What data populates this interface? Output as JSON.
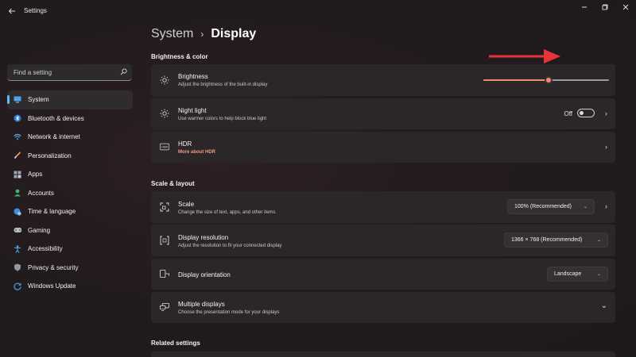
{
  "window": {
    "title": "Settings",
    "back_icon": "arrow-left-icon",
    "controls": [
      "minimize-icon",
      "maximize-icon",
      "close-icon"
    ]
  },
  "search": {
    "placeholder": "Find a setting",
    "icon": "search-icon"
  },
  "sidebar": {
    "items": [
      {
        "label": "System",
        "icon": "monitor-icon",
        "active": true
      },
      {
        "label": "Bluetooth & devices",
        "icon": "bluetooth-icon"
      },
      {
        "label": "Network & internet",
        "icon": "wifi-icon"
      },
      {
        "label": "Personalization",
        "icon": "brush-icon"
      },
      {
        "label": "Apps",
        "icon": "apps-grid-icon"
      },
      {
        "label": "Accounts",
        "icon": "person-icon"
      },
      {
        "label": "Time & language",
        "icon": "globe-clock-icon"
      },
      {
        "label": "Gaming",
        "icon": "gamepad-icon"
      },
      {
        "label": "Accessibility",
        "icon": "accessibility-icon"
      },
      {
        "label": "Privacy & security",
        "icon": "shield-icon"
      },
      {
        "label": "Windows Update",
        "icon": "update-icon"
      }
    ]
  },
  "breadcrumb": {
    "parent": "System",
    "separator": "›",
    "current": "Display"
  },
  "sections": {
    "brightness_color": "Brightness & color",
    "scale_layout": "Scale & layout",
    "related": "Related settings"
  },
  "brightness": {
    "title": "Brightness",
    "subtitle": "Adjust the brightness of the built-in display",
    "level": 0.52
  },
  "night_light": {
    "title": "Night light",
    "subtitle": "Use warmer colors to help block blue light",
    "state": "Off"
  },
  "hdr": {
    "title": "HDR",
    "link": "More about HDR"
  },
  "scale": {
    "title": "Scale",
    "subtitle": "Change the size of text, apps, and other items",
    "value": "100% (Recommended)"
  },
  "resolution": {
    "title": "Display resolution",
    "subtitle": "Adjust the resolution to fit your connected display",
    "value": "1366 × 768 (Recommended)"
  },
  "orientation": {
    "title": "Display orientation",
    "value": "Landscape"
  },
  "multiple_displays": {
    "title": "Multiple displays",
    "subtitle": "Choose the presentation mode for your displays"
  },
  "colors": {
    "accent_slider": "#ef8a6f",
    "nav_indicator": "#62b8f0",
    "hdr_link": "#f0997b",
    "annotation_arrow": "#e8323c"
  }
}
